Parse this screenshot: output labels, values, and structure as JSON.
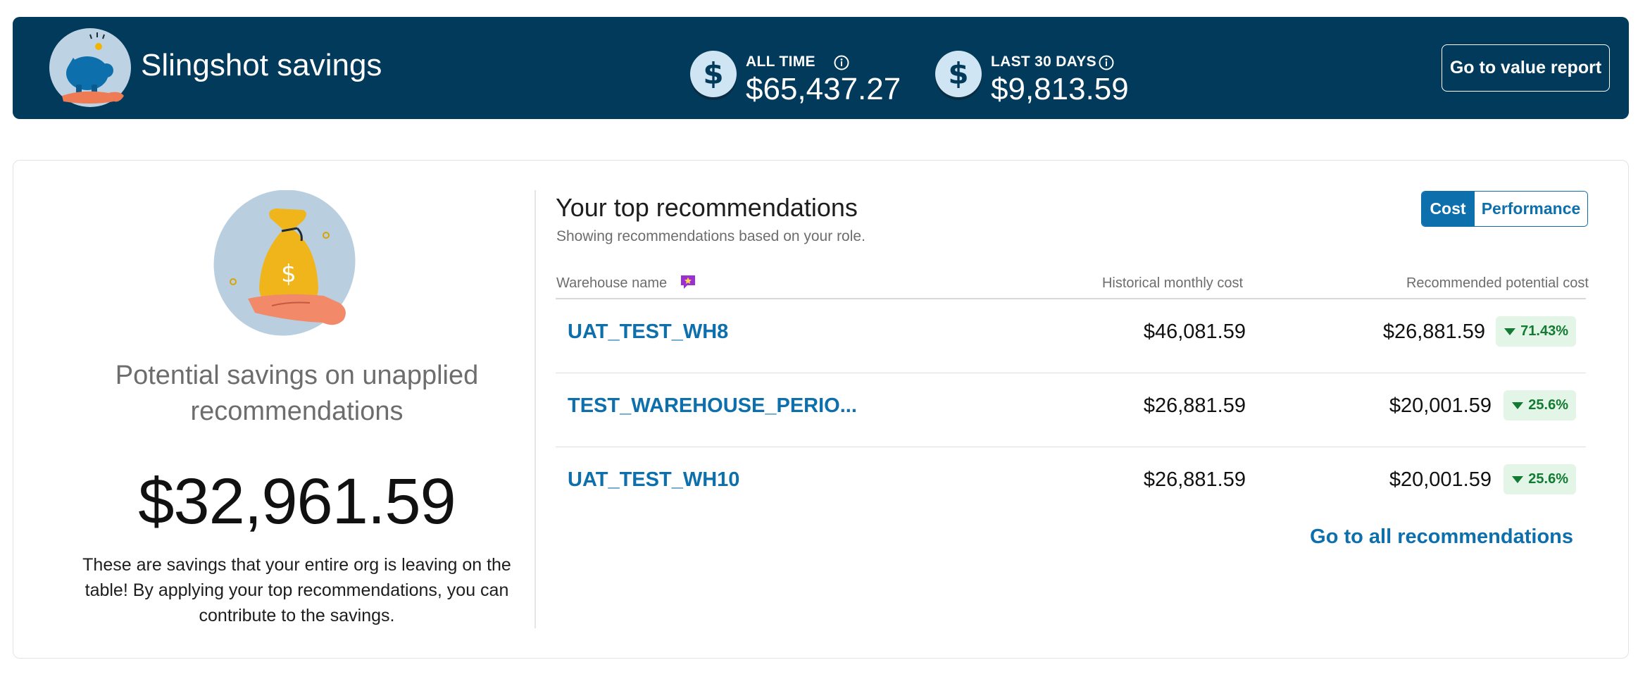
{
  "banner": {
    "title": "Slingshot savings",
    "all_time": {
      "label": "ALL TIME",
      "value": "$65,437.27",
      "icon": "dollar-coin-icon"
    },
    "last_30": {
      "label": "LAST 30 DAYS",
      "value": "$9,813.59",
      "icon": "dollar-coin-icon"
    },
    "value_report_button": "Go to value report"
  },
  "potential": {
    "title": "Potential savings on unapplied recommendations",
    "amount": "$32,961.59",
    "description": "These are savings that your entire org is leaving on the table! By applying your top recommendations, you can contribute to the savings."
  },
  "recommendations": {
    "title": "Your top recommendations",
    "subtitle": "Showing recommendations based on your role.",
    "toggle": {
      "active": "Cost",
      "inactive": "Performance"
    },
    "columns": {
      "warehouse": "Warehouse name",
      "historical": "Historical monthly cost",
      "recommended": "Recommended potential cost"
    },
    "rows": [
      {
        "warehouse": "UAT_TEST_WH8",
        "historical": "$46,081.59",
        "recommended": "$26,881.59",
        "change": "71.43%"
      },
      {
        "warehouse": "TEST_WAREHOUSE_PERIO...",
        "historical": "$26,881.59",
        "recommended": "$20,001.59",
        "change": "25.6%"
      },
      {
        "warehouse": "UAT_TEST_WH10",
        "historical": "$26,881.59",
        "recommended": "$20,001.59",
        "change": "25.6%"
      }
    ],
    "all_link": "Go to all recommendations"
  },
  "colors": {
    "banner_bg": "#013a5a",
    "accent": "#0e6fad",
    "badge_bg": "#e3f5e7",
    "badge_text": "#137a33"
  }
}
